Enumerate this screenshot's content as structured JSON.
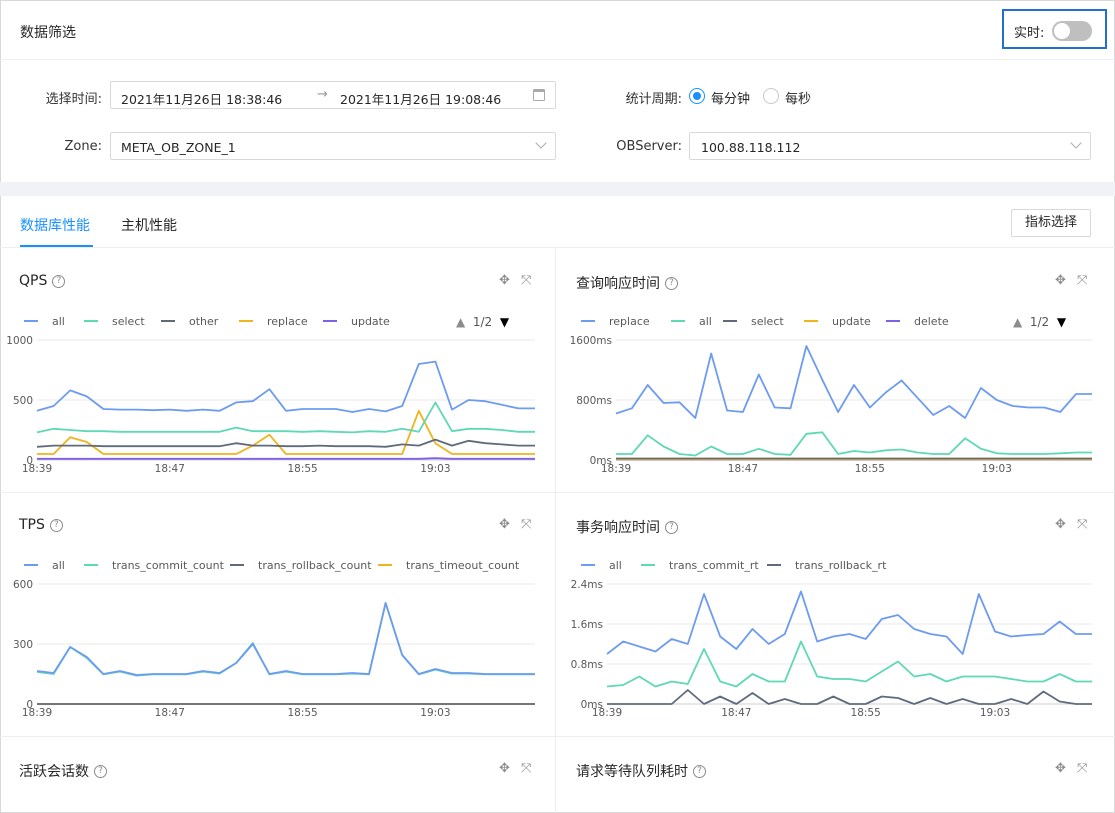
{
  "header": {
    "title": "数据筛选",
    "realtime_label": "实时:",
    "realtime_on": false
  },
  "filters": {
    "time_label": "选择时间:",
    "time_start": "2021年11月26日 18:38:46",
    "time_sep": "→",
    "time_end": "2021年11月26日 19:08:46",
    "zone_label": "Zone:",
    "zone_value": "META_OB_ZONE_1",
    "period_label": "统计周期:",
    "period_options": [
      {
        "label": "每分钟",
        "selected": true
      },
      {
        "label": "每秒",
        "selected": false
      }
    ],
    "observer_label": "OBServer:",
    "observer_value": "100.88.118.112"
  },
  "tabs": [
    {
      "label": "数据库性能",
      "active": true
    },
    {
      "label": "主机性能",
      "active": false
    }
  ],
  "metric_button": "指标选择",
  "icons": [
    "question-circle-icon",
    "drag-icon",
    "fullscreen-icon",
    "calendar-icon",
    "chevron-down-icon"
  ],
  "panels": [
    {
      "title": "QPS",
      "pager": "1/2"
    },
    {
      "title": "查询响应时间",
      "pager": "1/2"
    },
    {
      "title": "TPS",
      "pager": ""
    },
    {
      "title": "事务响应时间",
      "pager": ""
    },
    {
      "title": "活跃会话数",
      "pager": ""
    },
    {
      "title": "请求等待队列耗时",
      "pager": ""
    }
  ],
  "chart_data": [
    {
      "type": "line",
      "x": [
        "18:39",
        "18:40",
        "18:41",
        "18:42",
        "18:43",
        "18:44",
        "18:45",
        "18:46",
        "18:47",
        "18:48",
        "18:49",
        "18:50",
        "18:51",
        "18:52",
        "18:53",
        "18:54",
        "18:55",
        "18:56",
        "18:57",
        "18:58",
        "18:59",
        "19:00",
        "19:01",
        "19:02",
        "19:03",
        "19:04",
        "19:05",
        "19:06",
        "19:07",
        "19:08",
        "19:09"
      ],
      "xticks": [
        "18:39",
        "18:47",
        "18:55",
        "19:03"
      ],
      "yticks": [
        "0",
        "500",
        "1000"
      ],
      "ylim": [
        0,
        1000
      ],
      "series": [
        {
          "name": "all",
          "color": "#6d9bf2",
          "values": [
            410,
            450,
            580,
            530,
            425,
            420,
            420,
            415,
            420,
            410,
            420,
            410,
            480,
            490,
            590,
            410,
            425,
            425,
            425,
            400,
            425,
            405,
            450,
            800,
            820,
            420,
            500,
            490,
            460,
            430,
            430
          ]
        },
        {
          "name": "select",
          "color": "#5fd8b4",
          "values": [
            230,
            260,
            250,
            240,
            240,
            235,
            235,
            235,
            235,
            235,
            235,
            235,
            270,
            240,
            240,
            240,
            235,
            240,
            235,
            230,
            240,
            235,
            260,
            235,
            480,
            240,
            260,
            260,
            250,
            235,
            235
          ]
        },
        {
          "name": "other",
          "color": "#5f6b7c",
          "values": [
            110,
            120,
            120,
            120,
            115,
            115,
            115,
            115,
            115,
            115,
            115,
            115,
            140,
            120,
            120,
            115,
            115,
            120,
            115,
            115,
            115,
            110,
            130,
            120,
            170,
            120,
            160,
            140,
            130,
            120,
            120
          ]
        },
        {
          "name": "replace",
          "color": "#f0b41c",
          "values": [
            50,
            50,
            190,
            150,
            50,
            50,
            50,
            50,
            50,
            50,
            50,
            50,
            50,
            120,
            210,
            50,
            50,
            50,
            50,
            50,
            50,
            50,
            50,
            410,
            140,
            50,
            50,
            50,
            50,
            50,
            50
          ]
        },
        {
          "name": "update",
          "color": "#7f5fe6",
          "values": [
            10,
            10,
            10,
            10,
            10,
            10,
            10,
            10,
            10,
            10,
            10,
            10,
            10,
            10,
            10,
            10,
            10,
            10,
            10,
            10,
            10,
            10,
            10,
            10,
            15,
            10,
            10,
            10,
            10,
            10,
            10
          ]
        }
      ],
      "legend_pager": "1/2"
    },
    {
      "type": "line",
      "x": [
        "18:39",
        "18:40",
        "18:41",
        "18:42",
        "18:43",
        "18:44",
        "18:45",
        "18:46",
        "18:47",
        "18:48",
        "18:49",
        "18:50",
        "18:51",
        "18:52",
        "18:53",
        "18:54",
        "18:55",
        "18:56",
        "18:57",
        "18:58",
        "18:59",
        "19:00",
        "19:01",
        "19:02",
        "19:03",
        "19:04",
        "19:05",
        "19:06",
        "19:07",
        "19:08",
        "19:09"
      ],
      "xticks": [
        "18:39",
        "18:47",
        "18:55",
        "19:03"
      ],
      "yticks": [
        "0ms",
        "800ms",
        "1600ms"
      ],
      "ylim": [
        0,
        1600
      ],
      "series": [
        {
          "name": "replace",
          "color": "#6d9bf2",
          "values": [
            620,
            690,
            1000,
            760,
            770,
            560,
            1420,
            660,
            640,
            1140,
            700,
            690,
            1520,
            1070,
            640,
            1000,
            700,
            900,
            1060,
            830,
            600,
            720,
            560,
            960,
            800,
            720,
            700,
            700,
            640,
            880,
            880
          ]
        },
        {
          "name": "all",
          "color": "#5fd8b4",
          "values": [
            80,
            80,
            330,
            180,
            80,
            60,
            180,
            80,
            80,
            150,
            80,
            70,
            350,
            370,
            80,
            120,
            100,
            130,
            140,
            100,
            80,
            80,
            290,
            150,
            90,
            80,
            80,
            80,
            90,
            100,
            100
          ]
        },
        {
          "name": "select",
          "color": "#5f6b7c",
          "values": [
            20,
            20,
            20,
            20,
            20,
            20,
            20,
            20,
            20,
            20,
            20,
            20,
            20,
            20,
            20,
            20,
            20,
            20,
            20,
            20,
            20,
            20,
            20,
            20,
            20,
            20,
            20,
            20,
            20,
            20,
            20
          ]
        },
        {
          "name": "update",
          "color": "#f0b41c",
          "values": [
            10,
            10,
            10,
            10,
            10,
            10,
            10,
            10,
            10,
            10,
            10,
            10,
            10,
            10,
            10,
            10,
            10,
            10,
            10,
            10,
            10,
            10,
            10,
            10,
            10,
            10,
            10,
            10,
            10,
            10,
            10
          ]
        },
        {
          "name": "delete",
          "color": "#7f5fe6",
          "values": [
            5,
            5,
            5,
            5,
            5,
            5,
            5,
            5,
            5,
            5,
            5,
            5,
            5,
            5,
            5,
            5,
            5,
            5,
            5,
            5,
            5,
            5,
            5,
            5,
            5,
            5,
            5,
            5,
            5,
            5,
            5
          ]
        }
      ],
      "legend_pager": "1/2"
    },
    {
      "type": "line",
      "x": [
        "18:39",
        "18:40",
        "18:41",
        "18:42",
        "18:43",
        "18:44",
        "18:45",
        "18:46",
        "18:47",
        "18:48",
        "18:49",
        "18:50",
        "18:51",
        "18:52",
        "18:53",
        "18:54",
        "18:55",
        "18:56",
        "18:57",
        "18:58",
        "18:59",
        "19:00",
        "19:01",
        "19:02",
        "19:03",
        "19:04",
        "19:05",
        "19:06",
        "19:07",
        "19:08",
        "19:09"
      ],
      "xticks": [
        "18:39",
        "18:47",
        "18:55",
        "19:03"
      ],
      "yticks": [
        "0",
        "300",
        "600"
      ],
      "ylim": [
        0,
        600
      ],
      "series": [
        {
          "name": "all",
          "color": "#6d9bf2",
          "values": [
            165,
            155,
            285,
            235,
            150,
            165,
            145,
            150,
            150,
            150,
            165,
            155,
            205,
            300,
            150,
            165,
            150,
            150,
            150,
            155,
            150,
            505,
            245,
            150,
            175,
            155,
            155,
            150,
            150,
            150,
            150
          ]
        },
        {
          "name": "trans_commit_count",
          "color": "#5fd8b4",
          "values": [
            160,
            150,
            285,
            230,
            148,
            162,
            142,
            148,
            148,
            148,
            162,
            152,
            205,
            305,
            148,
            162,
            148,
            148,
            148,
            152,
            148,
            505,
            245,
            148,
            172,
            152,
            152,
            148,
            148,
            148,
            148
          ]
        },
        {
          "name": "trans_rollback_count",
          "color": "#5f6b7c",
          "values": [
            0,
            0,
            0,
            0,
            0,
            0,
            0,
            0,
            0,
            0,
            0,
            0,
            0,
            0,
            0,
            0,
            0,
            0,
            0,
            0,
            0,
            0,
            0,
            0,
            0,
            0,
            0,
            0,
            0,
            0,
            0
          ]
        },
        {
          "name": "trans_timeout_count",
          "color": "#f0b41c",
          "values": [
            0,
            0,
            0,
            0,
            0,
            0,
            0,
            0,
            0,
            0,
            0,
            0,
            0,
            0,
            0,
            0,
            0,
            0,
            0,
            0,
            0,
            0,
            0,
            0,
            0,
            0,
            0,
            0,
            0,
            0,
            0
          ]
        }
      ]
    },
    {
      "type": "line",
      "x": [
        "18:39",
        "18:40",
        "18:41",
        "18:42",
        "18:43",
        "18:44",
        "18:45",
        "18:46",
        "18:47",
        "18:48",
        "18:49",
        "18:50",
        "18:51",
        "18:52",
        "18:53",
        "18:54",
        "18:55",
        "18:56",
        "18:57",
        "18:58",
        "18:59",
        "19:00",
        "19:01",
        "19:02",
        "19:03",
        "19:04",
        "19:05",
        "19:06",
        "19:07",
        "19:08",
        "19:09"
      ],
      "xticks": [
        "18:39",
        "18:47",
        "18:55",
        "19:03"
      ],
      "yticks": [
        "0ms",
        "0.8ms",
        "1.6ms",
        "2.4ms"
      ],
      "ylim": [
        0,
        2.4
      ],
      "series": [
        {
          "name": "all",
          "color": "#6d9bf2",
          "values": [
            1.0,
            1.25,
            1.15,
            1.05,
            1.3,
            1.2,
            2.2,
            1.35,
            1.1,
            1.5,
            1.2,
            1.4,
            2.25,
            1.25,
            1.35,
            1.4,
            1.3,
            1.7,
            1.78,
            1.5,
            1.4,
            1.35,
            1.0,
            2.2,
            1.45,
            1.35,
            1.38,
            1.4,
            1.65,
            1.4,
            1.4
          ]
        },
        {
          "name": "trans_commit_rt",
          "color": "#5fd8b4",
          "values": [
            0.35,
            0.38,
            0.55,
            0.35,
            0.45,
            0.4,
            1.1,
            0.45,
            0.35,
            0.6,
            0.45,
            0.45,
            1.25,
            0.55,
            0.5,
            0.5,
            0.45,
            0.65,
            0.85,
            0.55,
            0.6,
            0.45,
            0.55,
            0.55,
            0.55,
            0.5,
            0.45,
            0.45,
            0.6,
            0.45,
            0.45
          ]
        },
        {
          "name": "trans_rollback_rt",
          "color": "#5f6b7c",
          "values": [
            0,
            0,
            0,
            0,
            0,
            0.28,
            0,
            0.15,
            0,
            0.22,
            0,
            0.1,
            0,
            0,
            0.15,
            0,
            0,
            0.15,
            0.12,
            0,
            0.12,
            0,
            0.1,
            0,
            0,
            0.1,
            0,
            0.25,
            0.05,
            0,
            0
          ]
        }
      ]
    }
  ]
}
